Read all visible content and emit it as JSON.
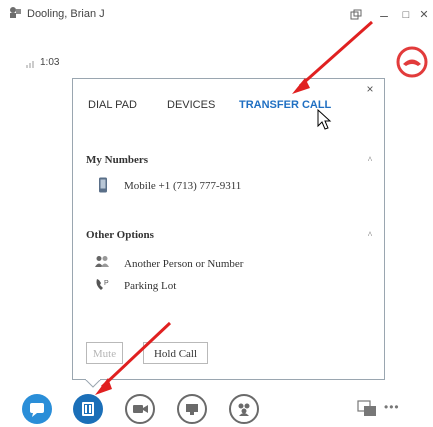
{
  "titlebar": {
    "title": "Dooling, Brian J",
    "buttons": {
      "restore": "⤢",
      "minimize": "–",
      "maximize": "□",
      "close": "✕"
    }
  },
  "call": {
    "duration": "1:03"
  },
  "panel": {
    "close_label": "×",
    "tabs": [
      {
        "label": "DIAL PAD"
      },
      {
        "label": "DEVICES"
      },
      {
        "label": "TRANSFER CALL",
        "active": true
      }
    ],
    "my_numbers": {
      "title": "My Numbers",
      "items": [
        {
          "label": "Mobile +1 (713) 777-9311",
          "icon": "mobile-icon"
        }
      ]
    },
    "other_options": {
      "title": "Other Options",
      "items": [
        {
          "label": "Another Person or Number",
          "icon": "people-icon"
        },
        {
          "label": "Parking Lot",
          "icon": "parking-icon"
        }
      ]
    },
    "mute_label": "Mute",
    "hold_label": "Hold Call"
  },
  "bottom_bar": {
    "icons": [
      "chat-icon",
      "call-controls-icon",
      "video-icon",
      "present-icon",
      "participants-icon"
    ],
    "more_label": "•••"
  },
  "colors": {
    "accent": "#1f6fc2",
    "hangup": "#e23b3b",
    "arrow": "#e02020"
  }
}
